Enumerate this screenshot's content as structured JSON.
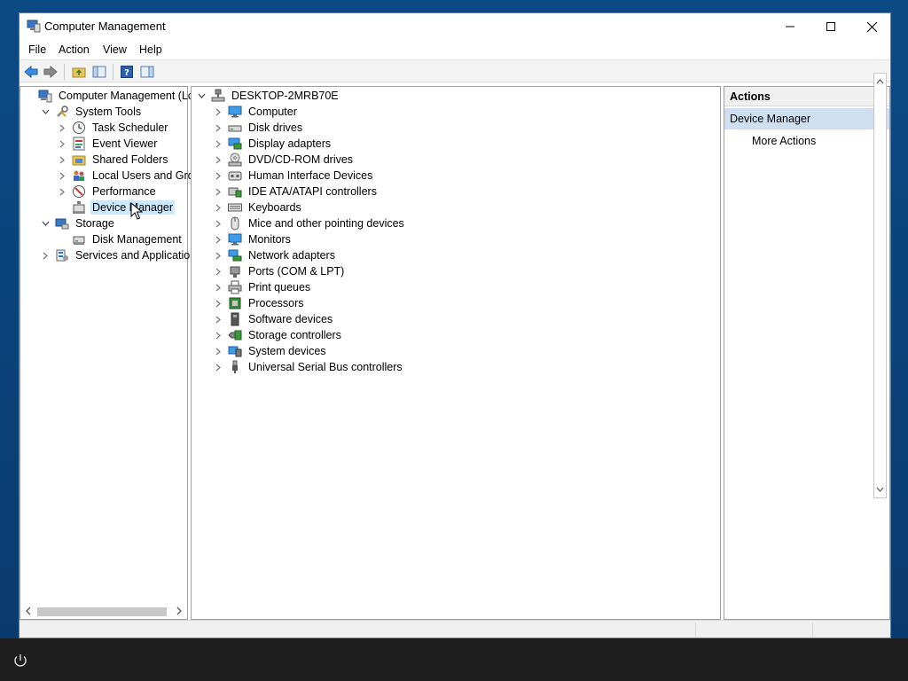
{
  "window": {
    "title": "Computer Management",
    "menu": [
      "File",
      "Action",
      "View",
      "Help"
    ]
  },
  "left_tree": [
    {
      "label": "Computer Management (Local",
      "level": 0,
      "expander": "none",
      "icon": "computer-management-icon"
    },
    {
      "label": "System Tools",
      "level": 1,
      "expander": "open",
      "icon": "tools-icon"
    },
    {
      "label": "Task Scheduler",
      "level": 2,
      "expander": "closed",
      "icon": "clock-icon"
    },
    {
      "label": "Event Viewer",
      "level": 2,
      "expander": "closed",
      "icon": "event-viewer-icon"
    },
    {
      "label": "Shared Folders",
      "level": 2,
      "expander": "closed",
      "icon": "shared-folder-icon"
    },
    {
      "label": "Local Users and Groups",
      "level": 2,
      "expander": "closed",
      "icon": "users-icon"
    },
    {
      "label": "Performance",
      "level": 2,
      "expander": "closed",
      "icon": "performance-icon"
    },
    {
      "label": "Device Manager",
      "level": 2,
      "expander": "none",
      "icon": "device-manager-icon",
      "selected": true
    },
    {
      "label": "Storage",
      "level": 1,
      "expander": "open",
      "icon": "storage-icon"
    },
    {
      "label": "Disk Management",
      "level": 2,
      "expander": "none",
      "icon": "disk-management-icon"
    },
    {
      "label": "Services and Applications",
      "level": 1,
      "expander": "closed",
      "icon": "services-icon"
    }
  ],
  "device_tree": {
    "root": "DESKTOP-2MRB70E",
    "items": [
      {
        "label": "Computer",
        "icon": "monitor-icon"
      },
      {
        "label": "Disk drives",
        "icon": "disk-drive-icon"
      },
      {
        "label": "Display adapters",
        "icon": "display-adapter-icon"
      },
      {
        "label": "DVD/CD-ROM drives",
        "icon": "dvd-icon"
      },
      {
        "label": "Human Interface Devices",
        "icon": "hid-icon"
      },
      {
        "label": "IDE ATA/ATAPI controllers",
        "icon": "ide-controller-icon"
      },
      {
        "label": "Keyboards",
        "icon": "keyboard-icon"
      },
      {
        "label": "Mice and other pointing devices",
        "icon": "mouse-icon"
      },
      {
        "label": "Monitors",
        "icon": "monitor-icon"
      },
      {
        "label": "Network adapters",
        "icon": "network-adapter-icon"
      },
      {
        "label": "Ports (COM & LPT)",
        "icon": "port-icon"
      },
      {
        "label": "Print queues",
        "icon": "printer-icon"
      },
      {
        "label": "Processors",
        "icon": "processor-icon"
      },
      {
        "label": "Software devices",
        "icon": "software-device-icon"
      },
      {
        "label": "Storage controllers",
        "icon": "storage-controller-icon"
      },
      {
        "label": "System devices",
        "icon": "system-device-icon"
      },
      {
        "label": "Universal Serial Bus controllers",
        "icon": "usb-icon"
      }
    ]
  },
  "actions": {
    "header": "Actions",
    "section": "Device Manager",
    "items": [
      "More Actions"
    ]
  },
  "colors": {
    "selection": "#cce8ff",
    "actions_section": "#cfdff0",
    "desktop": "#0c4a86"
  }
}
